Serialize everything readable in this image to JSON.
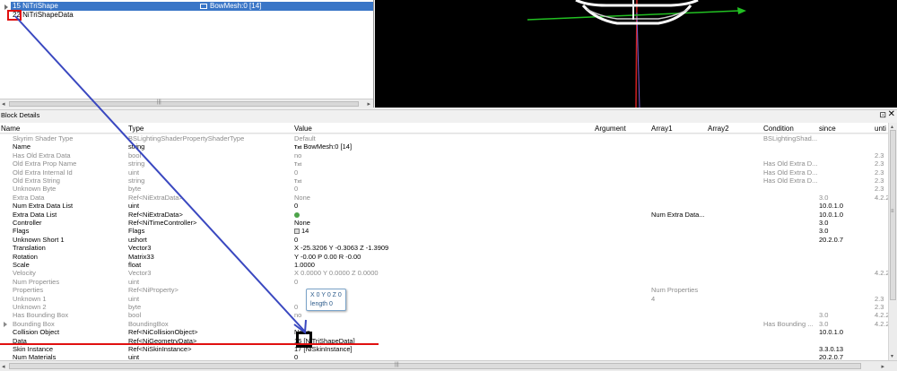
{
  "tree": {
    "rows": [
      {
        "label": "15 NiTriShape",
        "value": "BowMesh:0 [14]"
      },
      {
        "label": "22 NiTriShapeData"
      }
    ]
  },
  "details": {
    "title": "Block Details",
    "pin": "⊡",
    "close": "✕"
  },
  "columns": {
    "name": "Name",
    "type": "Type",
    "value": "Value",
    "argument": "Argument",
    "array1": "Array1",
    "array2": "Array2",
    "condition": "Condition",
    "since": "since",
    "until": "unti"
  },
  "rows": [
    {
      "name": "Skyrim Shader Type",
      "type": "BSLightingShaderPropertyShaderType",
      "value": "Default",
      "cond": "BSLightingShad...",
      "grey": true
    },
    {
      "name": "Name",
      "type": "string",
      "value": "BowMesh:0 [14]",
      "txt": "Txt"
    },
    {
      "name": "Has Old Extra Data",
      "type": "bool",
      "value": "no",
      "until": "2.3",
      "grey": true
    },
    {
      "name": "Old Extra Prop Name",
      "type": "string",
      "value": "",
      "txt": "Txt",
      "cond": "Has Old Extra D...",
      "until": "2.3",
      "grey": true
    },
    {
      "name": "Old Extra Internal Id",
      "type": "uint",
      "value": "0",
      "cond": "Has Old Extra D...",
      "until": "2.3",
      "grey": true
    },
    {
      "name": "Old Extra String",
      "type": "string",
      "value": "",
      "txt": "Txt",
      "cond": "Has Old Extra D...",
      "until": "2.3",
      "grey": true
    },
    {
      "name": "Unknown Byte",
      "type": "byte",
      "value": "0",
      "until": "2.3",
      "grey": true
    },
    {
      "name": "Extra Data",
      "type": "Ref<NiExtraData>",
      "value": "None",
      "since": "3.0",
      "until": "4.2.2",
      "grey": true
    },
    {
      "name": "Num Extra Data List",
      "type": "uint",
      "value": "0",
      "since": "10.0.1.0"
    },
    {
      "name": "Extra Data List",
      "type": "Ref<NiExtraData>",
      "value": "",
      "icon": "leaf",
      "arr1": "Num Extra Data...",
      "since": "10.0.1.0"
    },
    {
      "name": "Controller",
      "type": "Ref<NiTimeController>",
      "value": "None",
      "since": "3.0"
    },
    {
      "name": "Flags",
      "type": "Flags",
      "value": "14",
      "icon": "flag",
      "since": "3.0"
    },
    {
      "name": "Unknown Short 1",
      "type": "ushort",
      "value": "0",
      "since": "20.2.0.7"
    },
    {
      "name": "Translation",
      "type": "Vector3",
      "value": "X -25.3206 Y -0.3063 Z -1.3909"
    },
    {
      "name": "Rotation",
      "type": "Matrix33",
      "value": "Y -0.00 P 0.00 R -0.00"
    },
    {
      "name": "Scale",
      "type": "float",
      "value": "1.0000"
    },
    {
      "name": "Velocity",
      "type": "Vector3",
      "value": "X 0.0000 Y 0.0000 Z 0.0000",
      "until": "4.2.2",
      "grey": true
    },
    {
      "name": "Num Properties",
      "type": "uint",
      "value": "0",
      "grey": true
    },
    {
      "name": "Properties",
      "type": "Ref<NiProperty>",
      "value": "",
      "arr1": "Num Properties",
      "grey": true
    },
    {
      "name": "Unknown 1",
      "type": "uint",
      "value": "",
      "arr1": "4",
      "until": "2.3",
      "grey": true
    },
    {
      "name": "Unknown 2",
      "type": "byte",
      "value": "0",
      "until": "2.3",
      "grey": true
    },
    {
      "name": "Has Bounding Box",
      "type": "bool",
      "value": "no",
      "since": "3.0",
      "until": "4.2.2",
      "grey": true
    },
    {
      "name": "Bounding Box",
      "type": "BoundingBox",
      "value": "",
      "cond": "Has Bounding ...",
      "since": "3.0",
      "until": "4.2.2",
      "grey": true,
      "expander": true
    },
    {
      "name": "Collision Object",
      "type": "Ref<NiCollisionObject>",
      "value": "None",
      "since": "10.0.1.0"
    },
    {
      "name": "Data",
      "type": "Ref<NiGeometryData>",
      "value": "16 [NiTriShapeData]"
    },
    {
      "name": "Skin Instance",
      "type": "Ref<NiSkinInstance>",
      "value": "17 [NiSkinInstance]",
      "since": "3.3.0.13"
    },
    {
      "name": "Num Materials",
      "type": "uint",
      "value": "0",
      "since": "20.2.0.7"
    }
  ],
  "tooltip": {
    "line1": "X 0 Y 0 Z 0",
    "line2": "length 0"
  },
  "colors": {
    "selection": "#3a76c7",
    "annotation_red": "#e01010",
    "annotation_blue": "#3a48c0",
    "axis_green": "#22c022",
    "axis_red": "#d02020"
  }
}
